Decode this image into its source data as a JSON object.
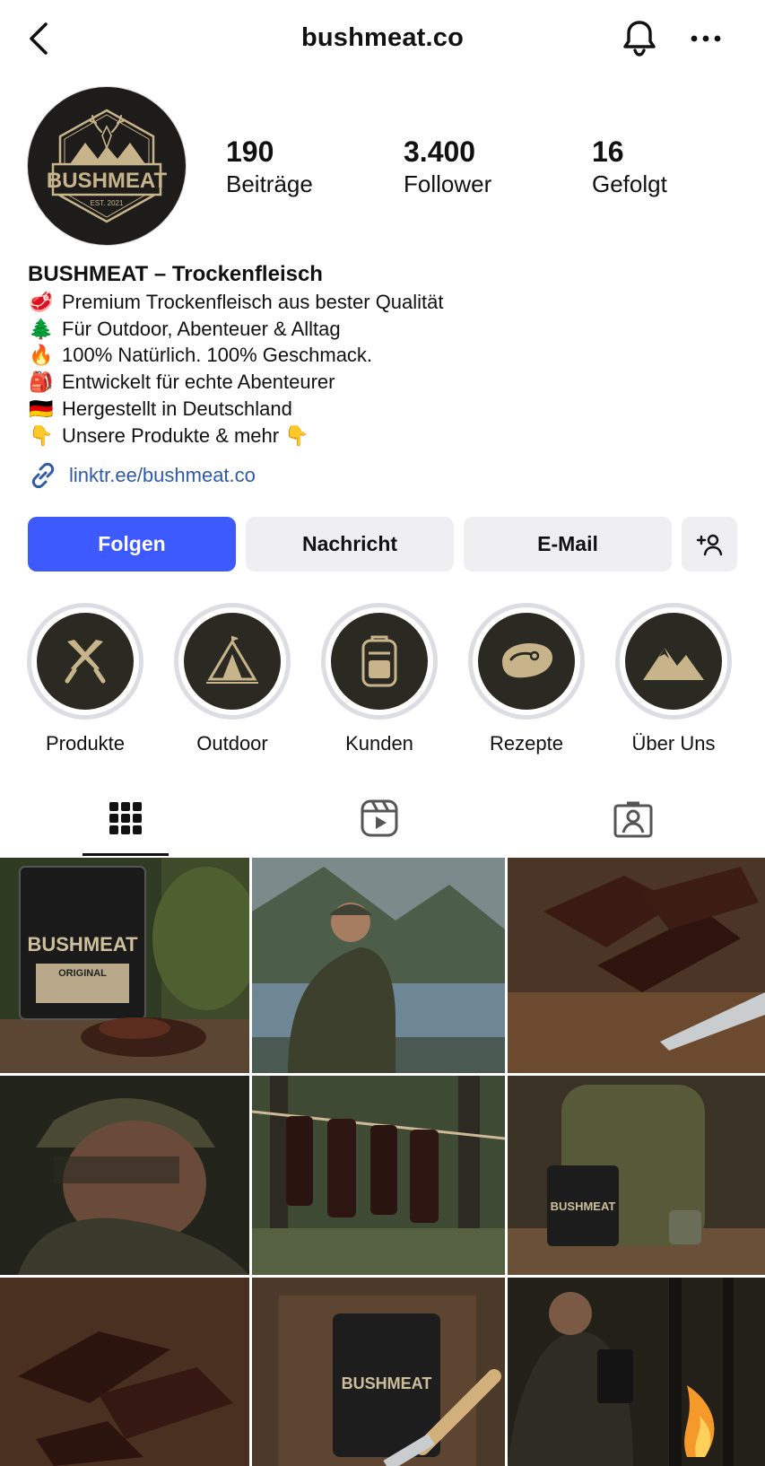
{
  "header": {
    "username": "bushmeat.co",
    "back_icon": "chevron-left-icon",
    "bell_icon": "bell-icon",
    "more_icon": "more-horizontal-icon"
  },
  "avatar": {
    "logo_text": "BUSHMEAT",
    "est_text": "EST. 2021"
  },
  "stats": [
    {
      "value": "190",
      "label": "Beiträge"
    },
    {
      "value": "3.400",
      "label": "Follower"
    },
    {
      "value": "16",
      "label": "Gefolgt"
    }
  ],
  "bio": {
    "name": "BUSHMEAT – Trockenfleisch",
    "lines": [
      {
        "emoji": "🥩",
        "text": "Premium Trockenfleisch aus bester Qualität"
      },
      {
        "emoji": "🌲",
        "text": "Für Outdoor, Abenteuer & Alltag"
      },
      {
        "emoji": "🔥",
        "text": "100% Natürlich. 100% Geschmack."
      },
      {
        "emoji": "🎒",
        "text": "Entwickelt für echte Abenteurer"
      },
      {
        "emoji": "🇩🇪",
        "text": "Hergestellt in Deutschland"
      },
      {
        "emoji": "👇",
        "text": "Unsere Produkte & mehr 👇"
      }
    ],
    "link": "linktr.ee/bushmeat.co"
  },
  "buttons": {
    "follow": "Folgen",
    "message": "Nachricht",
    "email": "E-Mail",
    "add_user_icon": "add-user-icon"
  },
  "highlights": [
    {
      "label": "Produkte",
      "icon": "crossed-knives-icon"
    },
    {
      "label": "Outdoor",
      "icon": "tent-icon"
    },
    {
      "label": "Kunden",
      "icon": "backpack-icon"
    },
    {
      "label": "Rezepte",
      "icon": "steak-icon"
    },
    {
      "label": "Über Uns",
      "icon": "mountains-icon"
    }
  ],
  "tabs": [
    {
      "name": "grid",
      "icon": "grid-icon",
      "active": true
    },
    {
      "name": "reels",
      "icon": "reels-icon",
      "active": false
    },
    {
      "name": "tagged",
      "icon": "tagged-icon",
      "active": false
    }
  ],
  "posts": [
    {
      "desc": "BUSHMEAT jerky pack on mossy forest stump",
      "pack_text": "BUSHMEAT",
      "pack_sub": "ORIGINAL"
    },
    {
      "desc": "Hiker eating jerky by mountain lake"
    },
    {
      "desc": "Jerky strips on wooden board with knife"
    },
    {
      "desc": "Man in camo hat eating jerky"
    },
    {
      "desc": "Jerky strips drying on line in forest"
    },
    {
      "desc": "Backpack with BUSHMEAT pack and mug",
      "pack_text": "BUSHMEAT"
    },
    {
      "desc": "Jerky pieces on rustic wood"
    },
    {
      "desc": "BUSHMEAT pack with knife and rope",
      "pack_text": "BUSHMEAT"
    },
    {
      "desc": "Man at campfire holding BUSHMEAT pack"
    }
  ],
  "colors": {
    "accent": "#3d5afe",
    "link": "#2f5aa8",
    "gold": "#c8b48a"
  }
}
